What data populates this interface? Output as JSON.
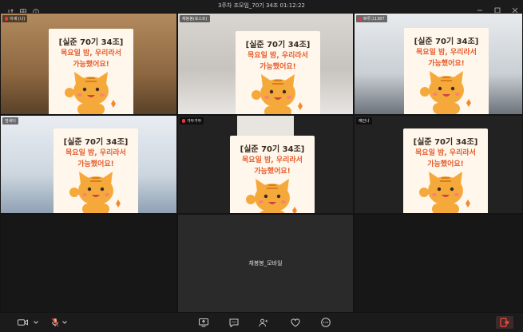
{
  "window": {
    "title": "3주차 조모임_70기 34조 01:12:22"
  },
  "participants": [
    {
      "name": "이새 (나)"
    },
    {
      "name": "채봉봉(호스트)"
    },
    {
      "name": "쁘루그1387"
    },
    {
      "name": "엠새터"
    },
    {
      "name": "가두가두"
    },
    {
      "name": "예안나"
    },
    {
      "name": ""
    },
    {
      "name": "채봉봉_모바일"
    },
    {
      "name": ""
    }
  ],
  "sticker": {
    "line1": "[실준 70기 34조]",
    "line2": "목요일 밤, 우리라서",
    "line3": "가능했어요!"
  },
  "toolbar": {
    "items": [
      "camera-icon",
      "mic-icon",
      "share-screen-icon",
      "chat-icon",
      "participants-icon",
      "reactions-icon",
      "more-icon",
      "leave-icon"
    ]
  }
}
